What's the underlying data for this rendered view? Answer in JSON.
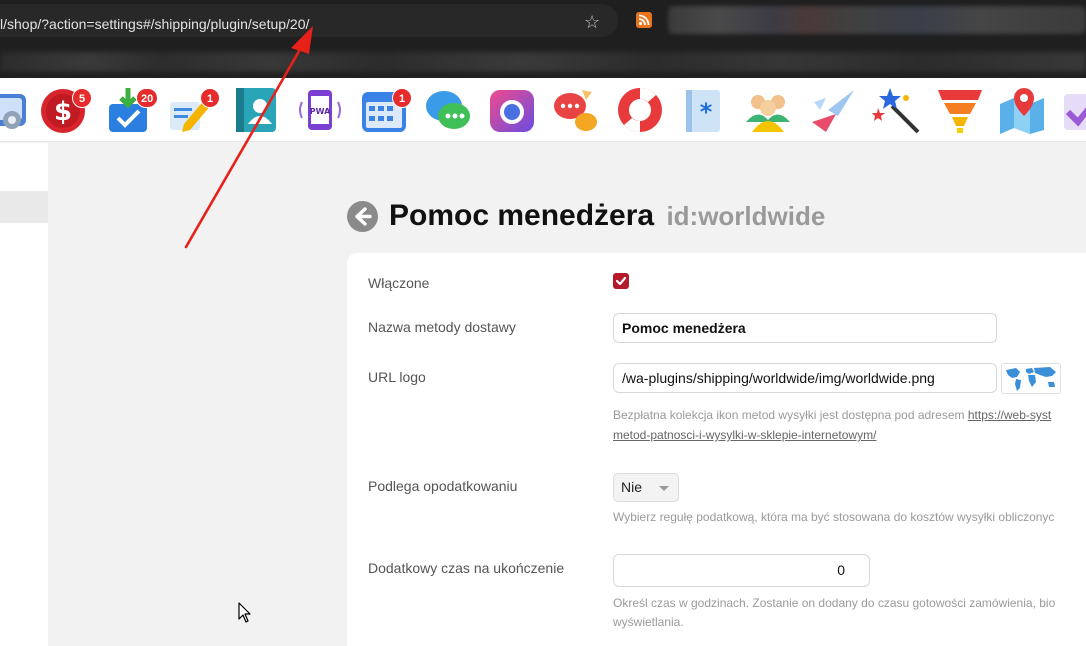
{
  "browser": {
    "url": "l/shop/?action=settings#/shipping/plugin/setup/20/",
    "star_icon": "star-icon",
    "rss_icon": "rss-feed-icon"
  },
  "apps": [
    {
      "icon": "settings-app-icon",
      "badge": ""
    },
    {
      "icon": "shop-dollar-icon",
      "badge": "5"
    },
    {
      "icon": "tasks-download-icon",
      "badge": "20"
    },
    {
      "icon": "blog-pencil-icon",
      "badge": "1"
    },
    {
      "icon": "contacts-icon",
      "badge": ""
    },
    {
      "icon": "pwa-icon",
      "badge": ""
    },
    {
      "icon": "calendar-icon",
      "badge": "1"
    },
    {
      "icon": "chat-bubbles-icon",
      "badge": ""
    },
    {
      "icon": "camera-photos-icon",
      "badge": ""
    },
    {
      "icon": "team-chat-icon",
      "badge": ""
    },
    {
      "icon": "lifebuoy-support-icon",
      "badge": ""
    },
    {
      "icon": "document-asterisk-icon",
      "badge": ""
    },
    {
      "icon": "users-group-icon",
      "badge": ""
    },
    {
      "icon": "paper-planes-icon",
      "badge": ""
    },
    {
      "icon": "magic-wand-icon",
      "badge": ""
    },
    {
      "icon": "funnel-icon",
      "badge": ""
    },
    {
      "icon": "map-pin-icon",
      "badge": ""
    },
    {
      "icon": "checkmark-icon",
      "badge": ""
    }
  ],
  "page": {
    "title": "Pomoc menedżera",
    "subtitle": "id:worldwide"
  },
  "form": {
    "enabled_label": "Włączone",
    "enabled": true,
    "name_label": "Nazwa metody dostawy",
    "name_value": "Pomoc menedżera",
    "logo_label": "URL logo",
    "logo_value": "/wa-plugins/shipping/worldwide/img/worldwide.png",
    "logo_hint_text": "Bezpłatna kolekcja ikon metod wysyłki jest dostępna pod adresem ",
    "logo_hint_link1": "https://web-syst",
    "logo_hint_link2": "metod-patnosci-i-wysylki-w-sklepie-internetowym/",
    "tax_label": "Podlega opodatkowaniu",
    "tax_value": "Nie",
    "tax_hint": "Wybierz regułę podatkową, która ma być stosowana do kosztów wysyłki obliczonyc",
    "time_label": "Dodatkowy czas na ukończenie",
    "time_value": "0",
    "time_hint_1": "Określ czas w godzinach. Zostanie on dodany do czasu gotowości zamówienia, bio",
    "time_hint_2": "wyświetlania."
  },
  "colors": {
    "accent_red": "#b5192c",
    "badge_red": "#e52b2b",
    "annotation_arrow": "#e8201a"
  }
}
